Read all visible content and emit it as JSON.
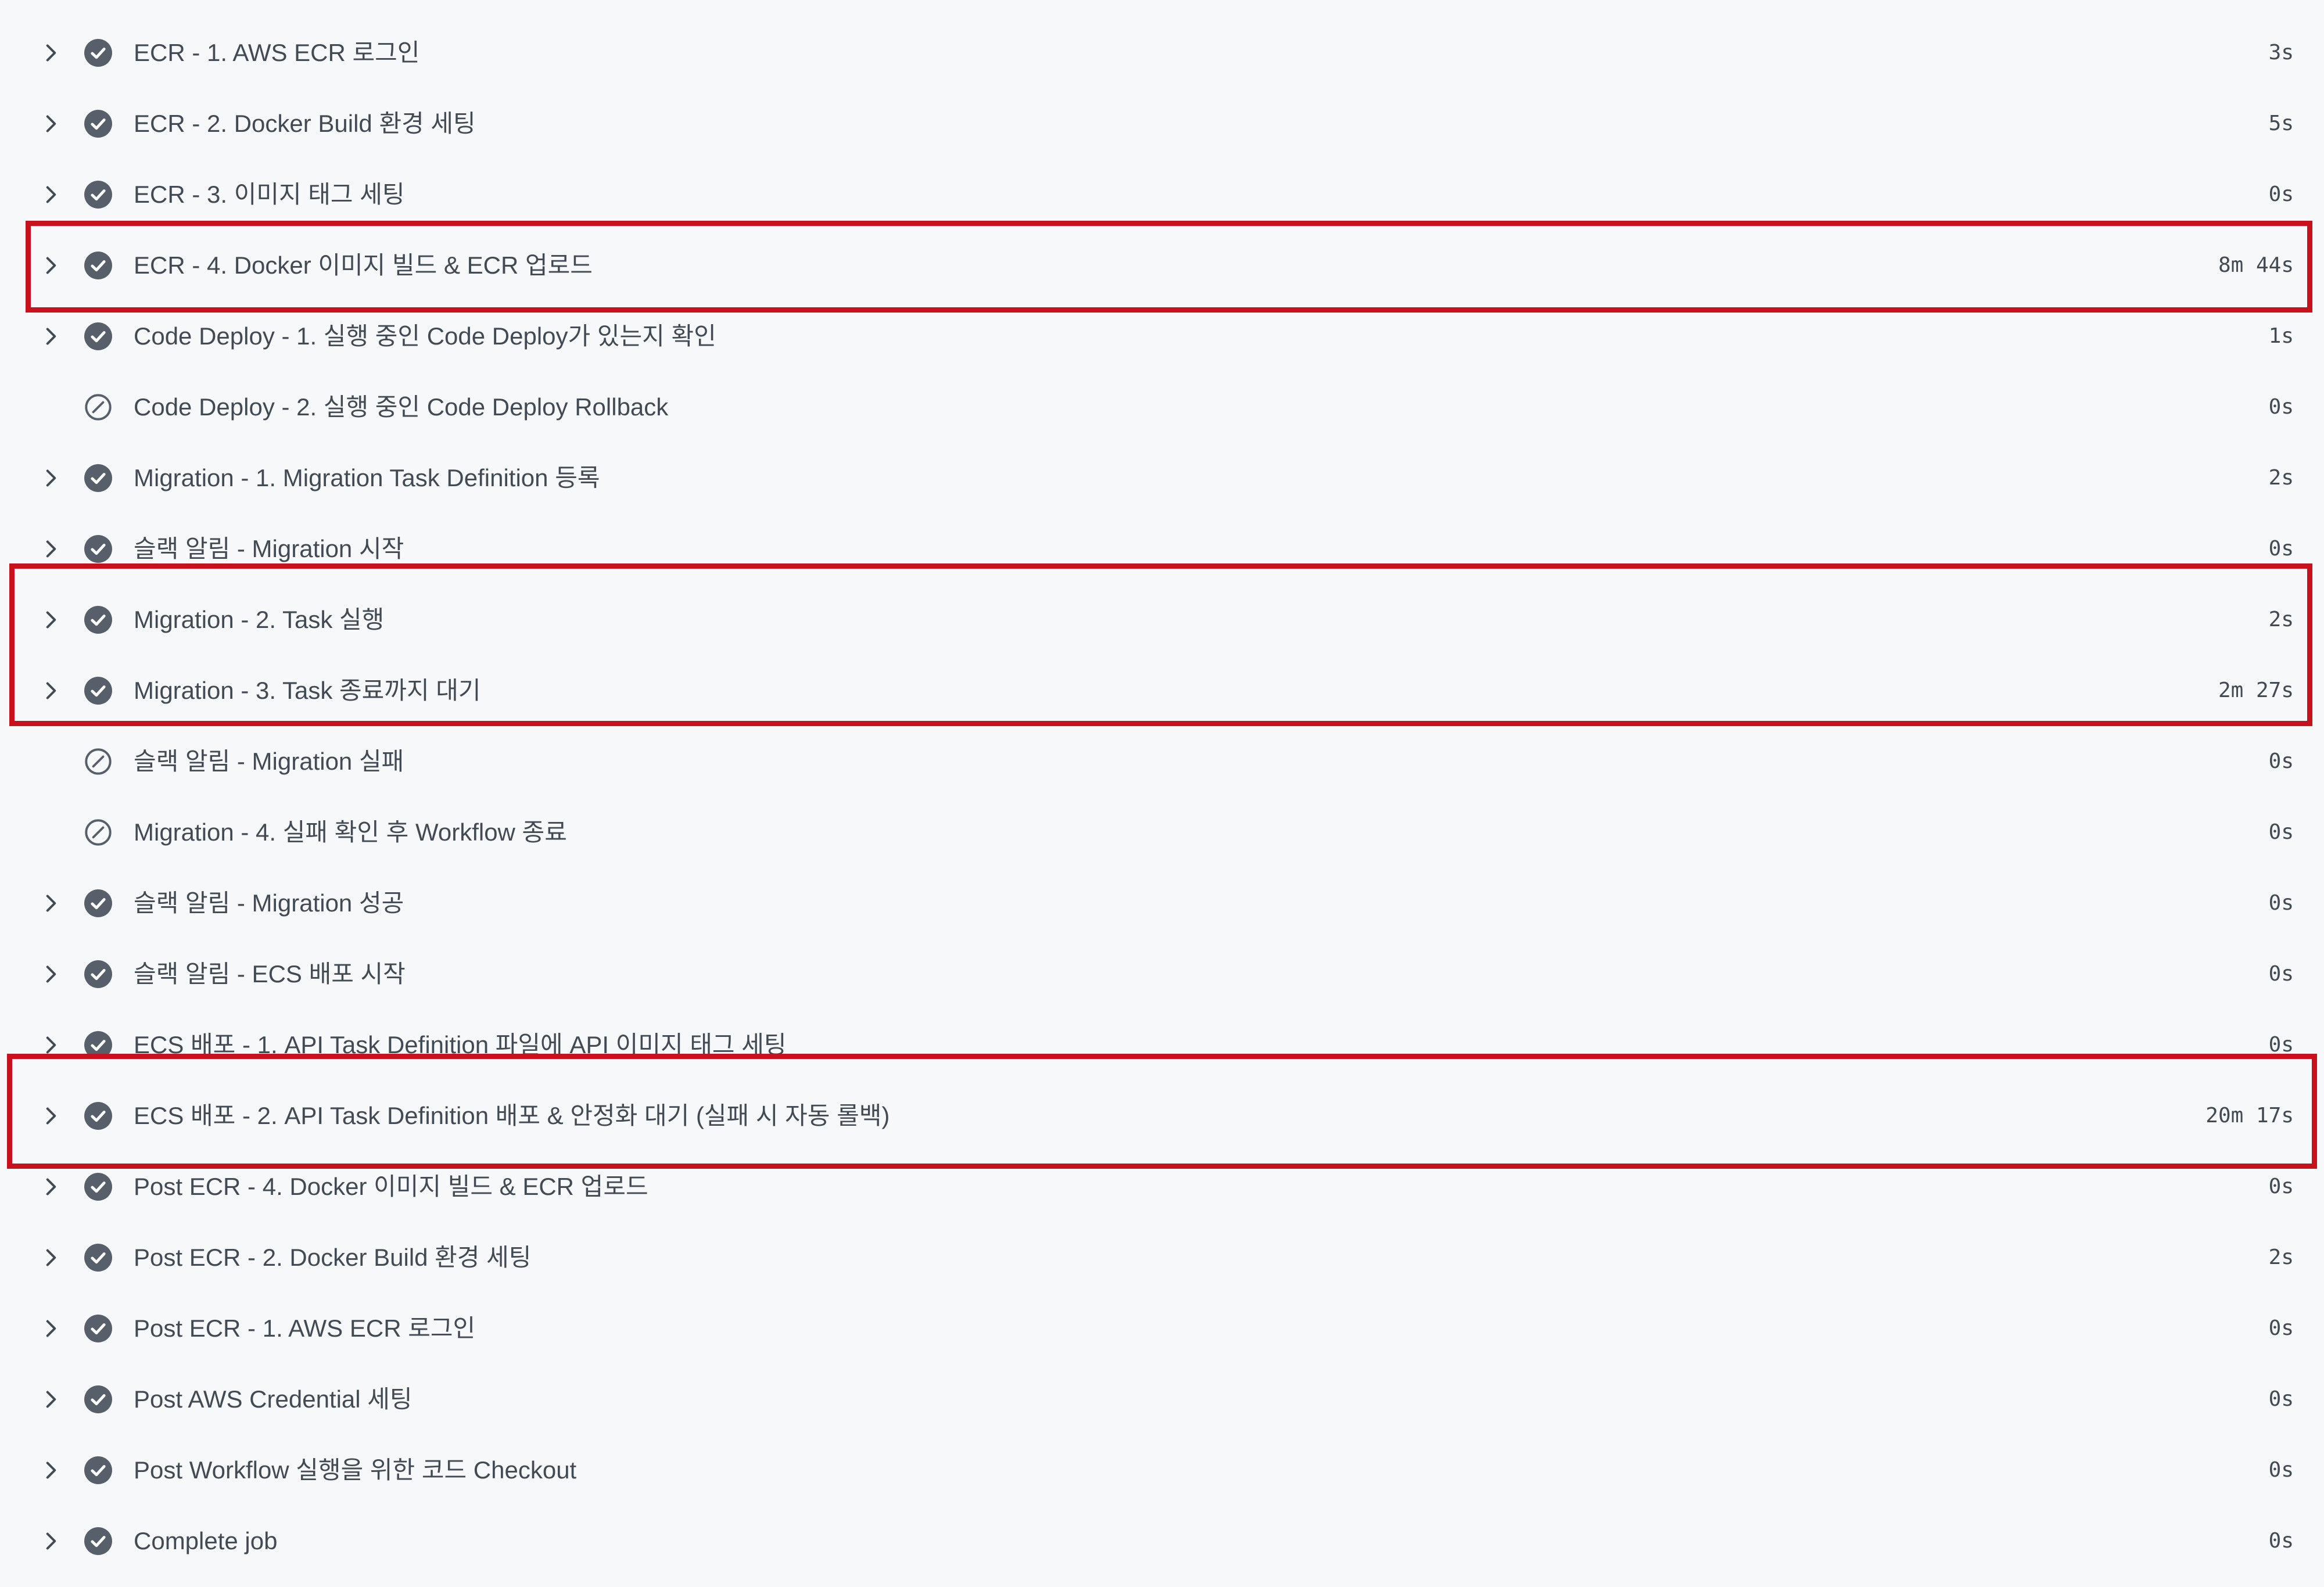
{
  "accent_color": "#c8111d",
  "icons": {
    "chevron": "chevron-right-icon",
    "success": "check-circle-icon",
    "skipped": "skipped-circle-icon"
  },
  "steps": [
    {
      "label": "ECR - 1. AWS ECR 로그인",
      "duration": "3s",
      "status": "success",
      "expandable": true
    },
    {
      "label": "ECR - 2. Docker Build 환경 세팅",
      "duration": "5s",
      "status": "success",
      "expandable": true
    },
    {
      "label": "ECR - 3. 이미지 태그 세팅",
      "duration": "0s",
      "status": "success",
      "expandable": true
    },
    {
      "label": "ECR - 4. Docker 이미지 빌드 & ECR 업로드",
      "duration": "8m 44s",
      "status": "success",
      "expandable": true
    },
    {
      "label": "Code Deploy - 1. 실행 중인 Code Deploy가 있는지 확인",
      "duration": "1s",
      "status": "success",
      "expandable": true
    },
    {
      "label": "Code Deploy - 2. 실행 중인 Code Deploy Rollback",
      "duration": "0s",
      "status": "skipped",
      "expandable": false
    },
    {
      "label": "Migration - 1. Migration Task Definition 등록",
      "duration": "2s",
      "status": "success",
      "expandable": true
    },
    {
      "label": "슬랙 알림 - Migration 시작",
      "duration": "0s",
      "status": "success",
      "expandable": true
    },
    {
      "label": "Migration - 2. Task 실행",
      "duration": "2s",
      "status": "success",
      "expandable": true
    },
    {
      "label": "Migration - 3. Task 종료까지 대기",
      "duration": "2m 27s",
      "status": "success",
      "expandable": true
    },
    {
      "label": "슬랙 알림 - Migration 실패",
      "duration": "0s",
      "status": "skipped",
      "expandable": false
    },
    {
      "label": "Migration - 4. 실패 확인 후 Workflow 종료",
      "duration": "0s",
      "status": "skipped",
      "expandable": false
    },
    {
      "label": "슬랙 알림 - Migration 성공",
      "duration": "0s",
      "status": "success",
      "expandable": true
    },
    {
      "label": "슬랙 알림 - ECS 배포 시작",
      "duration": "0s",
      "status": "success",
      "expandable": true
    },
    {
      "label": "ECS 배포 - 1. API Task Definition 파일에 API 이미지 태그 세팅",
      "duration": "0s",
      "status": "success",
      "expandable": true
    },
    {
      "label": "ECS 배포 - 2. API Task Definition 배포 & 안정화 대기 (실패 시 자동 롤백)",
      "duration": "20m 17s",
      "status": "success",
      "expandable": true
    },
    {
      "label": "Post ECR - 4. Docker 이미지 빌드 & ECR 업로드",
      "duration": "0s",
      "status": "success",
      "expandable": true
    },
    {
      "label": "Post ECR - 2. Docker Build 환경 세팅",
      "duration": "2s",
      "status": "success",
      "expandable": true
    },
    {
      "label": "Post ECR - 1. AWS ECR 로그인",
      "duration": "0s",
      "status": "success",
      "expandable": true
    },
    {
      "label": "Post AWS Credential 세팅",
      "duration": "0s",
      "status": "success",
      "expandable": true
    },
    {
      "label": "Post Workflow 실행을 위한 코드 Checkout",
      "duration": "0s",
      "status": "success",
      "expandable": true
    },
    {
      "label": "Complete job",
      "duration": "0s",
      "status": "success",
      "expandable": true
    }
  ]
}
